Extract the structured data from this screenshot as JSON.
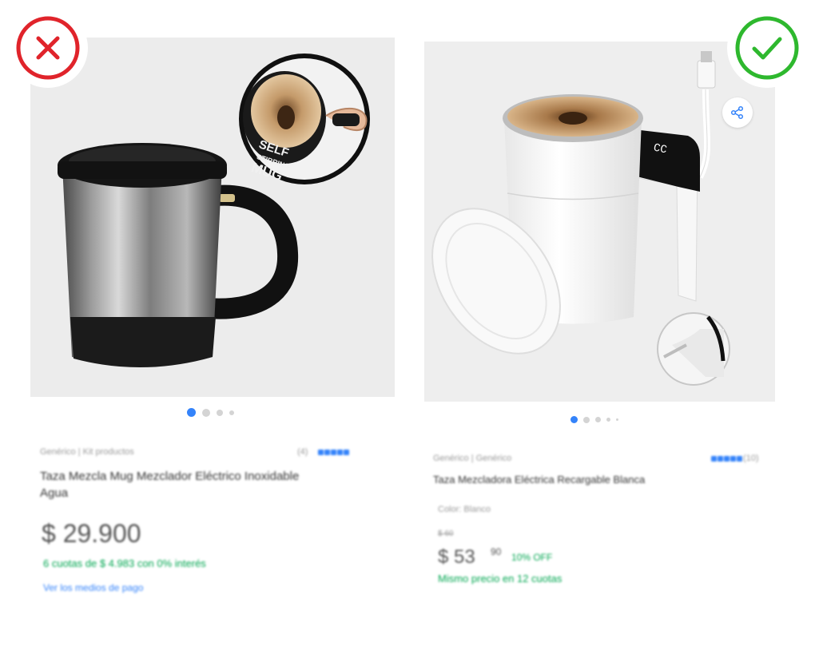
{
  "verdicts": {
    "left": {
      "icon": "x-circle-icon",
      "color": "#e0242b"
    },
    "right": {
      "icon": "check-circle-icon",
      "color": "#2eb82e"
    }
  },
  "left_card": {
    "image_label_lines": [
      "SELF",
      "STIRRING",
      "MUG"
    ],
    "carousel": {
      "count": 4,
      "active_index": 0
    },
    "brand": "Genérico | Kit productos",
    "rating_count": "(4)",
    "rating_stars": 5,
    "title_line1": "Taza Mezcla Mug Mezclador Eléctrico Inoxidable",
    "title_line2": "Agua",
    "price": "$ 29.900",
    "installments": "6 cuotas de $ 4.983 con 0% interés",
    "payment_link": "Ver los medios de pago"
  },
  "right_card": {
    "display_reading": "CC",
    "carousel": {
      "count": 5,
      "active_index": 0
    },
    "brand": "Genérico | Genérico",
    "rating_count": "(10)",
    "rating_stars": 5,
    "title": "Taza Mezcladora Eléctrica Recargable Blanca",
    "color_label": "Color: Blanco",
    "old_price": "$ 60",
    "price": "$ 53",
    "price_cents": "90",
    "discount": "10% OFF",
    "installments": "Mismo precio en 12 cuotas"
  },
  "colors": {
    "accent": "#3483fa",
    "success": "#00a650",
    "error": "#e0242b",
    "check": "#2eb82e"
  }
}
